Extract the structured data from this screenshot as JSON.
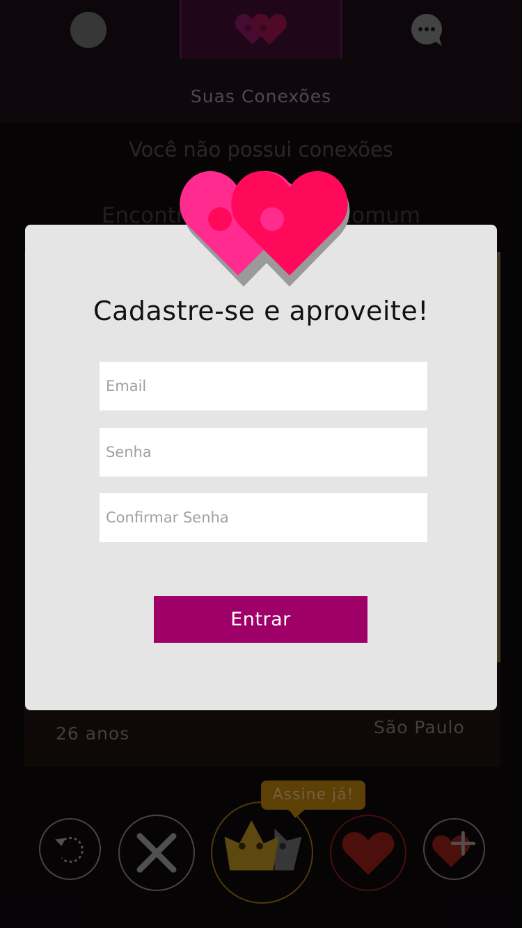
{
  "nav": {
    "profile_icon": "profile-avatar-icon",
    "connections_icon": "double-heart-icon",
    "chat_icon": "chat-bubble-icon"
  },
  "background": {
    "section_title": "Suas Conexões",
    "empty_message": "Você não possui conexões",
    "find_message": "Encontre pessoas em comum",
    "profile_age": "26 anos",
    "profile_city": "São Paulo"
  },
  "actions": {
    "tooltip": "Assine já!",
    "undo_icon": "undo-icon",
    "nope_icon": "close-x-icon",
    "crown_icon": "crown-icon",
    "like_icon": "heart-icon",
    "superlike_icon": "heart-plus-icon"
  },
  "modal": {
    "logo_icon": "double-heart-logo-icon",
    "title": "Cadastre-se e aproveite!",
    "email_placeholder": "Email",
    "password_placeholder": "Senha",
    "confirm_password_placeholder": "Confirmar Senha",
    "submit_label": "Entrar"
  },
  "colors": {
    "accent": "#9e0068",
    "heart_pink": "#ff2b8f",
    "heart_red": "#ff0a5b",
    "modal_bg": "#e5e5e5",
    "gold": "#7b5608"
  }
}
